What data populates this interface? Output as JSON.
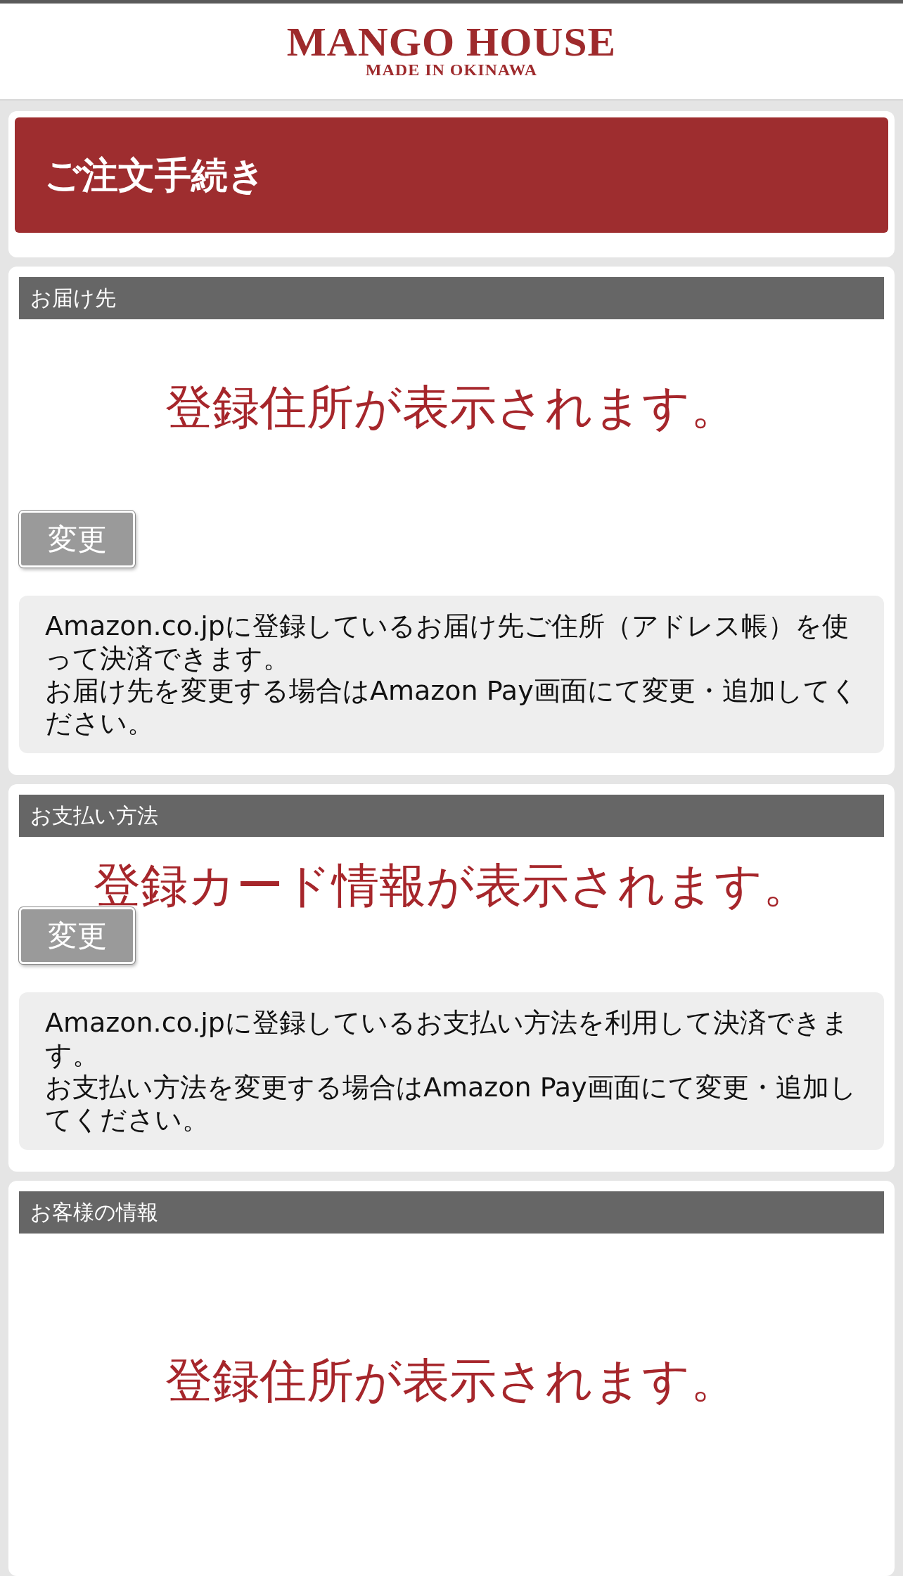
{
  "header": {
    "logo_title": "MANGO HOUSE",
    "logo_subtitle": "MADE IN OKINAWA"
  },
  "page_title": "ご注文手続き",
  "sections": [
    {
      "kind": "address",
      "title": "お届け先",
      "display_text": "登録住所が表示されます。",
      "button": "変更",
      "info": [
        "Amazon.co.jpに登録しているお届け先ご住所（アドレス帳）を使って決済できます。",
        "お届け先を変更する場合はAmazon Pay画面にて変更・追加してください。"
      ]
    },
    {
      "kind": "payment",
      "title": "お支払い方法",
      "display_text": "登録カード情報が表示されます。",
      "button": "変更",
      "info": [
        "Amazon.co.jpに登録しているお支払い方法を利用して決済できます。",
        "お支払い方法を変更する場合はAmazon Pay画面にて変更・追加してください。"
      ]
    },
    {
      "kind": "customer",
      "title": "お客様の情報",
      "display_text": "登録住所が表示されます。"
    }
  ]
}
